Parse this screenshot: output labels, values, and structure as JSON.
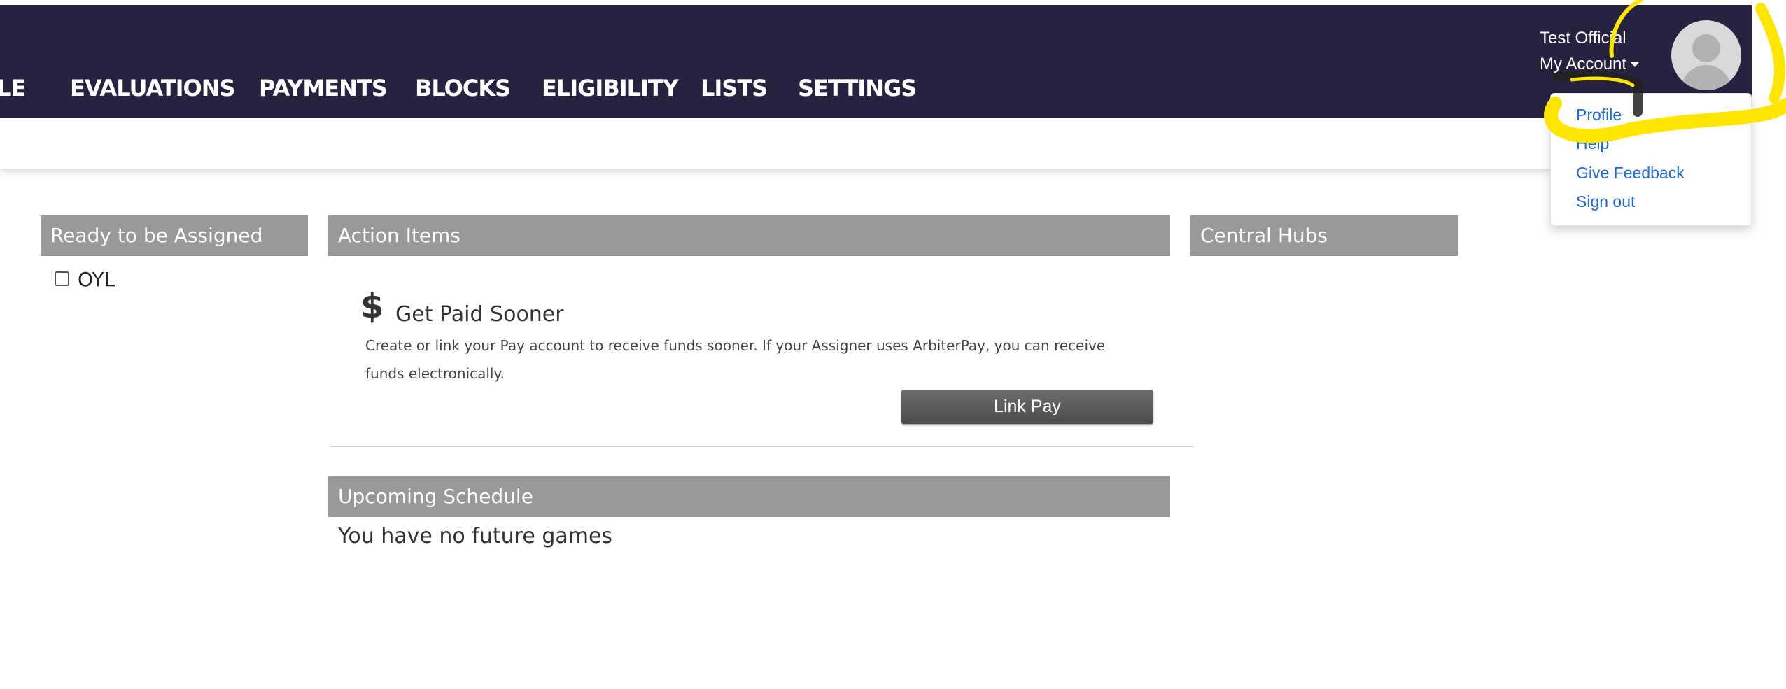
{
  "nav": {
    "items": [
      "LE",
      "EVALUATIONS",
      "PAYMENTS",
      "BLOCKS",
      "ELIGIBILITY",
      "LISTS",
      "SETTINGS"
    ]
  },
  "user": {
    "name": "Test Official",
    "account_label": "My Account"
  },
  "account_menu": {
    "items": [
      "Profile",
      "Help",
      "Give Feedback",
      "Sign out"
    ]
  },
  "ready_panel": {
    "title": "Ready to be Assigned",
    "items": [
      {
        "label": "OYL",
        "checked": false
      }
    ]
  },
  "action_panel": {
    "title": "Action Items",
    "get_paid": {
      "icon": "dollar-icon",
      "symbol": "$",
      "title": "Get Paid Sooner",
      "description": "Create or link your Pay account to receive funds sooner. If your Assigner uses ArbiterPay, you can receive funds electronically.",
      "button": "Link Pay"
    }
  },
  "schedule_panel": {
    "title": "Upcoming Schedule",
    "empty_text": "You have no future games"
  },
  "hubs_panel": {
    "title": "Central Hubs"
  },
  "colors": {
    "nav_bg": "#262240",
    "panel_header_bg": "#999999",
    "link": "#1e6ad6",
    "highlight_annotation": "#ffe600"
  }
}
